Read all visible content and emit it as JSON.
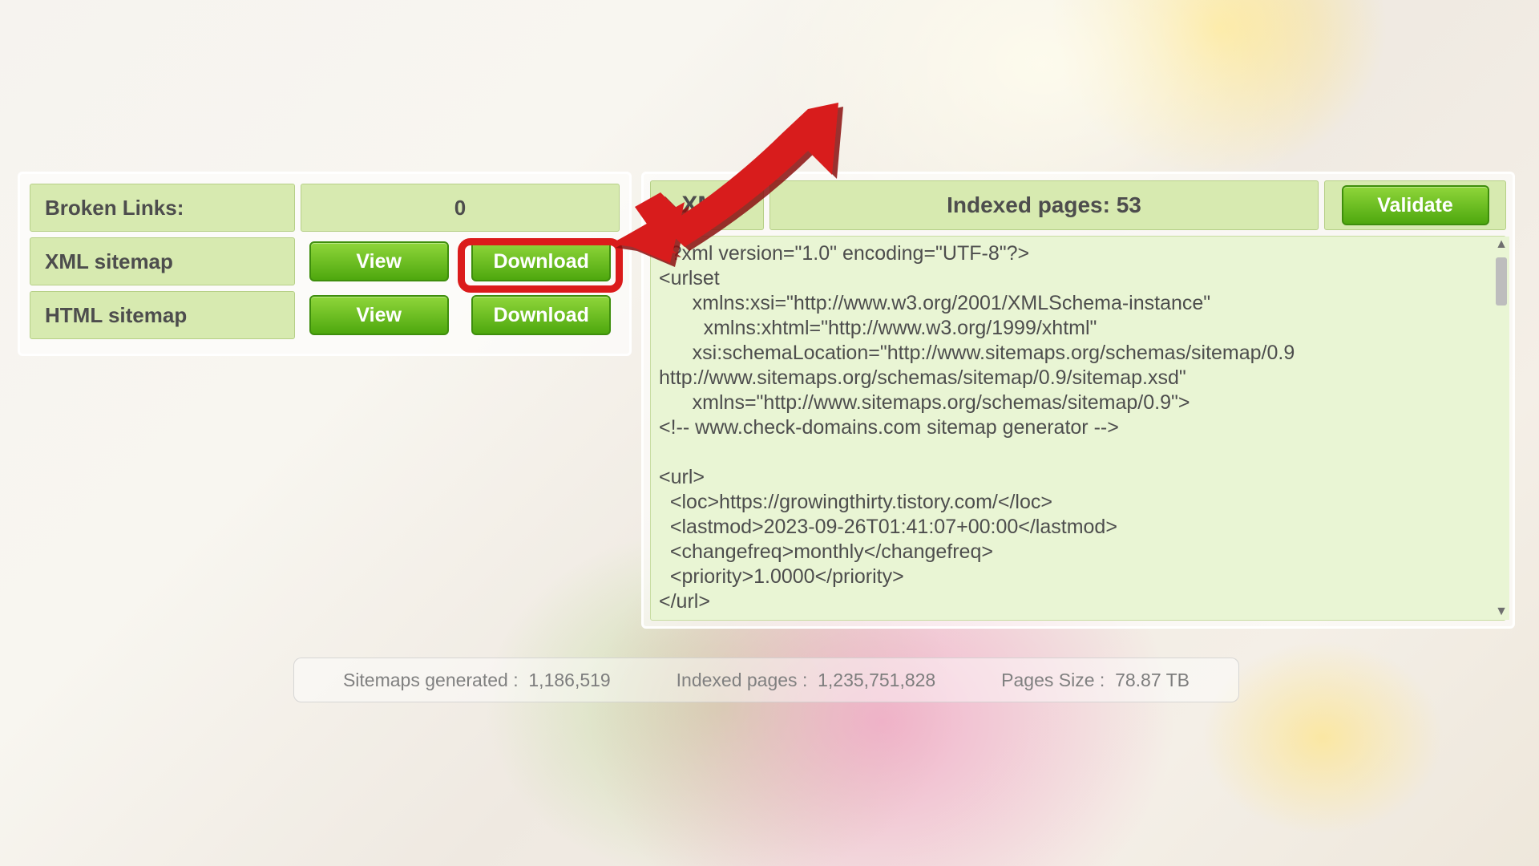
{
  "left": {
    "broken_links_label": "Broken Links:",
    "broken_links_value": "0",
    "xml_label": "XML sitemap",
    "html_label": "HTML sitemap",
    "view_label": "View",
    "download_label": "Download"
  },
  "right": {
    "tab_label": "XML",
    "indexed_label": "Indexed pages: 53",
    "validate_label": "Validate",
    "xml_text": "<?xml version=\"1.0\" encoding=\"UTF-8\"?>\n<urlset\n      xmlns:xsi=\"http://www.w3.org/2001/XMLSchema-instance\"\n        xmlns:xhtml=\"http://www.w3.org/1999/xhtml\"\n      xsi:schemaLocation=\"http://www.sitemaps.org/schemas/sitemap/0.9\nhttp://www.sitemaps.org/schemas/sitemap/0.9/sitemap.xsd\"\n      xmlns=\"http://www.sitemaps.org/schemas/sitemap/0.9\">\n<!-- www.check-domains.com sitemap generator -->\n\n<url>\n  <loc>https://growingthirty.tistory.com/</loc>\n  <lastmod>2023-09-26T01:41:07+00:00</lastmod>\n  <changefreq>monthly</changefreq>\n  <priority>1.0000</priority>\n</url>"
  },
  "stats": {
    "generated_label": "Sitemaps generated :",
    "generated_value": "1,186,519",
    "indexed_label": "Indexed pages :",
    "indexed_value": "1,235,751,828",
    "size_label": "Pages Size :",
    "size_value": "78.87 TB"
  }
}
